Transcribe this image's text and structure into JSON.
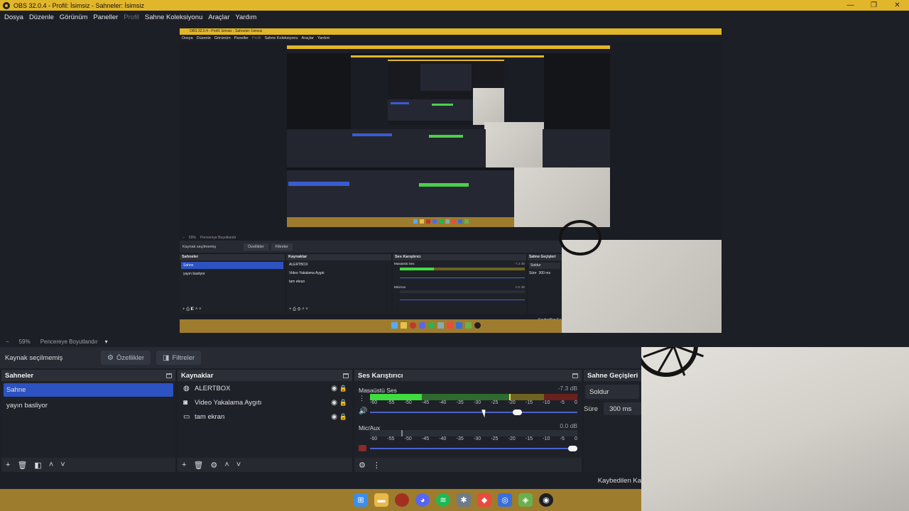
{
  "window": {
    "title": "OBS 32.0.4 - Profil: İsimsiz - Sahneler: İsimsiz",
    "minimize": "—",
    "maximize": "❐",
    "close": "✕"
  },
  "menu": {
    "items": [
      "Dosya",
      "Düzenle",
      "Görünüm",
      "Paneller",
      "Profil",
      "Sahne Koleksiyonu",
      "Araçlar",
      "Yardım"
    ],
    "disabled_index": 4
  },
  "preview": {
    "inner_title": "OBS 32.0.4 - Profil: İsimsiz - Sahneler: İsimsiz",
    "inner_menu": [
      "Dosya",
      "Düzenle",
      "Görünüm",
      "Paneller",
      "Profil",
      "Sahne Koleksiyonu",
      "Araçlar",
      "Yardım"
    ],
    "inner_nosrc": "Kaynak seçilmemiş",
    "inner_props": "Özellikler",
    "inner_filters": "Filtreler",
    "inner_zoom": "59%",
    "inner_fit": "Pencereye Boyutlandır",
    "inner_docks": [
      "Sahneler",
      "Kaynaklar",
      "Ses Karıştırıcı",
      "Sahne Geçişleri"
    ],
    "inner_scenes": [
      "Sahne",
      "yayın basliyor"
    ],
    "inner_sources": [
      "ALERTBOX",
      "Video Yakalama Aygıtı",
      "tam ekran"
    ],
    "inner_mix": [
      "Masaüstü Ses",
      "Mic/Aux"
    ],
    "inner_mix_db": [
      "-7.3 dB",
      "0.0 dB"
    ],
    "inner_trans": "Soldur",
    "inner_dur": "Süre",
    "inner_dur_val": "300 ms",
    "inner_status": "Kaybedilen Ka"
  },
  "zoom": {
    "minus": "−",
    "value": "59%",
    "fit_label": "Pencereye Boyutlandır",
    "caret": "▾"
  },
  "toolbar": {
    "no_source": "Kaynak seçilmemiş",
    "properties": "Özellikler",
    "filters": "Filtreler"
  },
  "scenes": {
    "title": "Sahneler",
    "items": [
      "Sahne",
      "yayın basliyor"
    ],
    "active_index": 0
  },
  "sources": {
    "title": "Kaynaklar",
    "items": [
      {
        "name": "ALERTBOX",
        "icon": "browser-icon"
      },
      {
        "name": "Video Yakalama Aygıtı",
        "icon": "camera-icon"
      },
      {
        "name": "tam ekran",
        "icon": "monitor-icon"
      }
    ]
  },
  "mixer": {
    "title": "Ses Karıştırıcı",
    "ticks": [
      "-60",
      "-55",
      "-50",
      "-45",
      "-40",
      "-35",
      "-30",
      "-25",
      "-20",
      "-15",
      "-10",
      "-5",
      "0"
    ],
    "channels": [
      {
        "name": "Masaüstü Ses",
        "db": "-7.3 dB",
        "level": 0.25,
        "peak": 0.67,
        "volume": 0.72,
        "muted": false
      },
      {
        "name": "Mic/Aux",
        "db": "0.0 dB",
        "level": 0.0,
        "peak": 0.15,
        "volume": 1.0,
        "muted": true
      }
    ]
  },
  "transitions": {
    "title": "Sahne Geçişleri",
    "selected": "Soldur",
    "duration_label": "Süre",
    "duration_value": "300 ms"
  },
  "status": {
    "text": "Kaybedilen Ka"
  },
  "taskbar": {
    "icons": [
      "windows-start-icon",
      "file-explorer-icon",
      "record-app-icon",
      "discord-icon",
      "spotify-icon",
      "settings-app-icon",
      "red-app-icon",
      "blue-app-icon",
      "green-app-icon",
      "obs-icon"
    ]
  },
  "colors": {
    "accent": "#e2b62a",
    "selection": "#2d52c2",
    "panel": "#1f2128",
    "meter_green": "#3fdc3f",
    "taskbar": "#9e7c2d"
  }
}
